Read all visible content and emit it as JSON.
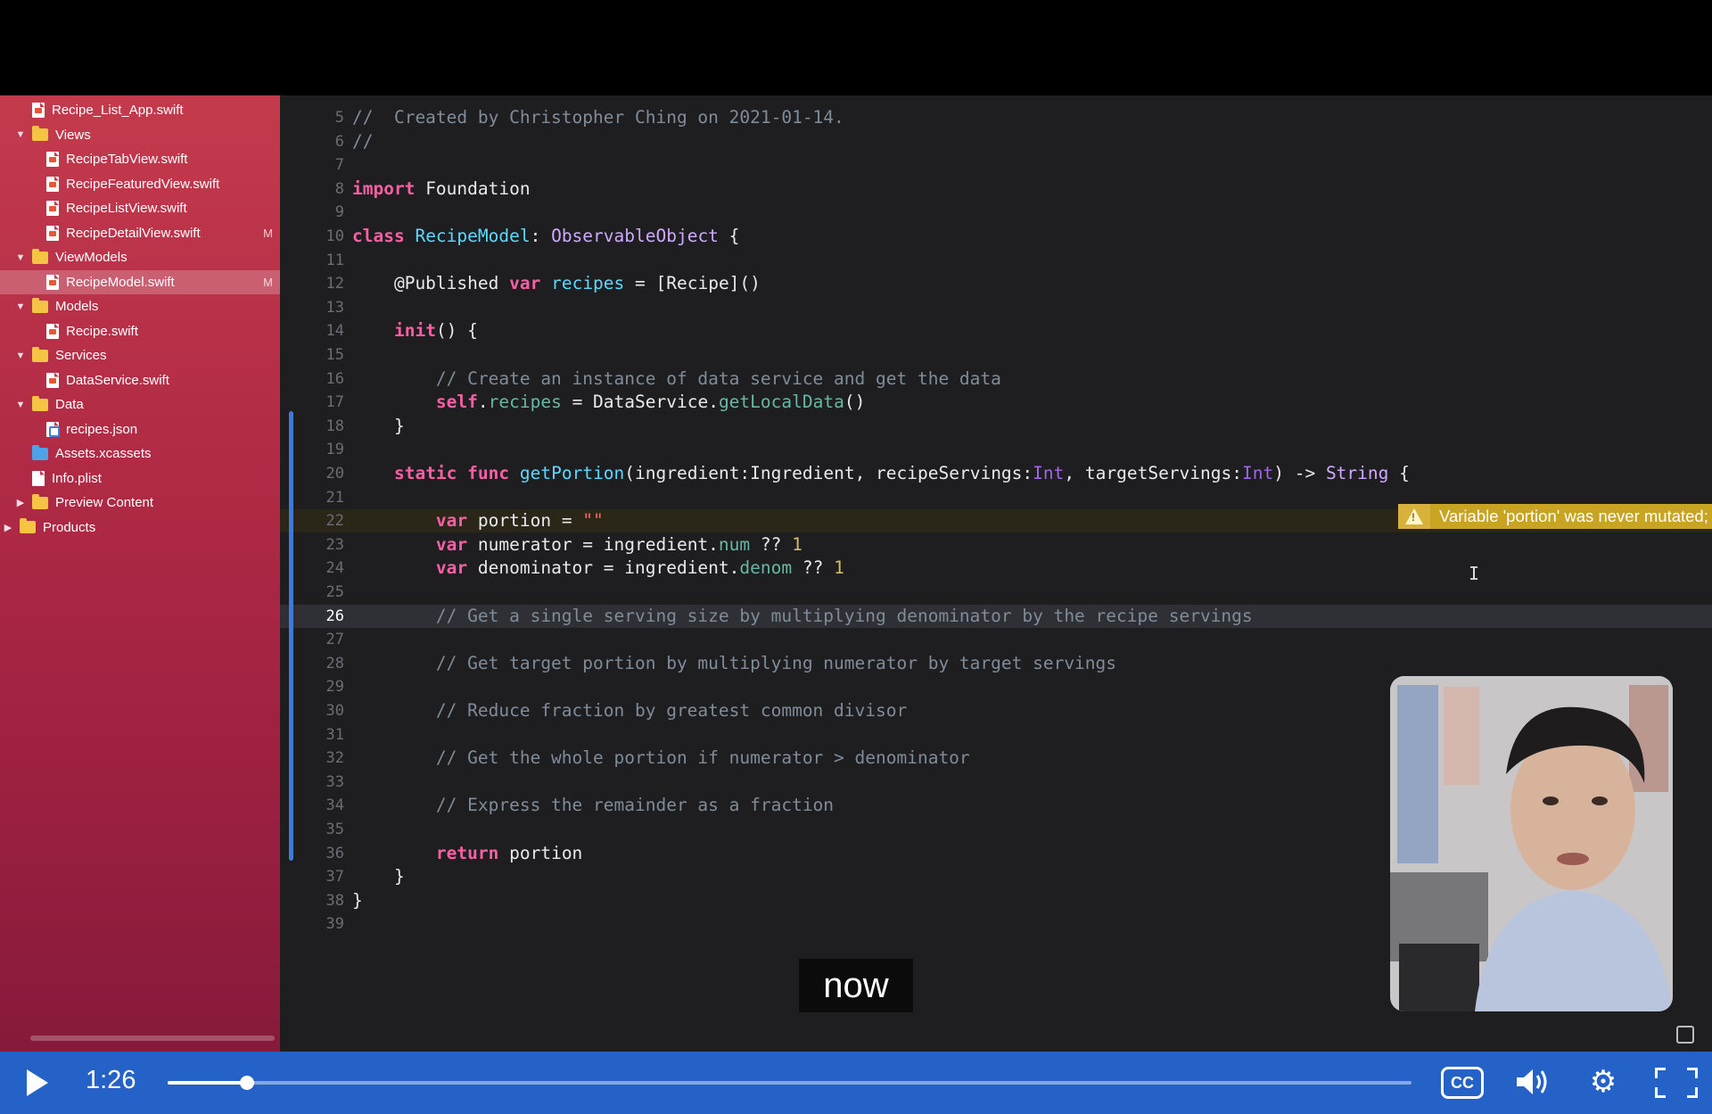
{
  "sidebar": {
    "items": [
      {
        "label": "Recipe_List_App.swift",
        "kind": "swift",
        "disclosure": "none",
        "badge": ""
      },
      {
        "label": "Views",
        "kind": "folder",
        "disclosure": "open",
        "badge": ""
      },
      {
        "label": "RecipeTabView.swift",
        "kind": "swift",
        "disclosure": "none",
        "badge": ""
      },
      {
        "label": "RecipeFeaturedView.swift",
        "kind": "swift",
        "disclosure": "none",
        "badge": ""
      },
      {
        "label": "RecipeListView.swift",
        "kind": "swift",
        "disclosure": "none",
        "badge": ""
      },
      {
        "label": "RecipeDetailView.swift",
        "kind": "swift",
        "disclosure": "none",
        "badge": "M"
      },
      {
        "label": "ViewModels",
        "kind": "folder",
        "disclosure": "open",
        "badge": ""
      },
      {
        "label": "RecipeModel.swift",
        "kind": "swift",
        "disclosure": "none",
        "badge": "M",
        "selected": true
      },
      {
        "label": "Models",
        "kind": "folder",
        "disclosure": "open",
        "badge": ""
      },
      {
        "label": "Recipe.swift",
        "kind": "swift",
        "disclosure": "none",
        "badge": ""
      },
      {
        "label": "Services",
        "kind": "folder",
        "disclosure": "open",
        "badge": ""
      },
      {
        "label": "DataService.swift",
        "kind": "swift",
        "disclosure": "none",
        "badge": ""
      },
      {
        "label": "Data",
        "kind": "folder",
        "disclosure": "open",
        "badge": ""
      },
      {
        "label": "recipes.json",
        "kind": "json",
        "disclosure": "none",
        "badge": ""
      },
      {
        "label": "Assets.xcassets",
        "kind": "asset",
        "disclosure": "none",
        "badge": ""
      },
      {
        "label": "Info.plist",
        "kind": "file",
        "disclosure": "none",
        "badge": ""
      },
      {
        "label": "Preview Content",
        "kind": "folder",
        "disclosure": "closed",
        "badge": ""
      },
      {
        "label": "Products",
        "kind": "folder",
        "disclosure": "closed",
        "badge": ""
      }
    ]
  },
  "editor": {
    "current_line": 26,
    "warning_line": 22,
    "lines": [
      {
        "n": 5,
        "code": [
          [
            "cm",
            "//  Created by Christopher Ching on 2021-01-14."
          ]
        ]
      },
      {
        "n": 6,
        "code": [
          [
            "cm",
            "//"
          ]
        ]
      },
      {
        "n": 7,
        "code": []
      },
      {
        "n": 8,
        "code": [
          [
            "kw",
            "import"
          ],
          [
            "",
            " Foundation"
          ]
        ]
      },
      {
        "n": 9,
        "code": []
      },
      {
        "n": 10,
        "code": [
          [
            "kw",
            "class"
          ],
          [
            "",
            " "
          ],
          [
            "prop",
            "RecipeModel"
          ],
          [
            "",
            ": "
          ],
          [
            "ty",
            "ObservableObject"
          ],
          [
            "",
            " {"
          ]
        ]
      },
      {
        "n": 11,
        "code": []
      },
      {
        "n": 12,
        "code": [
          [
            "",
            "    @Published "
          ],
          [
            "kw",
            "var"
          ],
          [
            "",
            " "
          ],
          [
            "prop",
            "recipes"
          ],
          [
            "",
            " = [Recipe]()"
          ]
        ]
      },
      {
        "n": 13,
        "code": []
      },
      {
        "n": 14,
        "code": [
          [
            "",
            "    "
          ],
          [
            "kw",
            "init"
          ],
          [
            "",
            "() {"
          ]
        ]
      },
      {
        "n": 15,
        "code": []
      },
      {
        "n": 16,
        "code": [
          [
            "cm",
            "        // Create an instance of data service and get the data"
          ]
        ]
      },
      {
        "n": 17,
        "code": [
          [
            "",
            "        "
          ],
          [
            "kw",
            "self"
          ],
          [
            "",
            "."
          ],
          [
            "fn",
            "recipes"
          ],
          [
            "",
            " = DataService."
          ],
          [
            "fn",
            "getLocalData"
          ],
          [
            "",
            "()"
          ]
        ]
      },
      {
        "n": 18,
        "code": [
          [
            "",
            "    }"
          ]
        ]
      },
      {
        "n": 19,
        "code": []
      },
      {
        "n": 20,
        "code": [
          [
            "",
            "    "
          ],
          [
            "kw",
            "static"
          ],
          [
            "",
            " "
          ],
          [
            "kw",
            "func"
          ],
          [
            "",
            " "
          ],
          [
            "prop",
            "getPortion"
          ],
          [
            "",
            "(ingredient:Ingredient, recipeServings:"
          ],
          [
            "ty2",
            "Int"
          ],
          [
            "",
            ", targetServings:"
          ],
          [
            "ty2",
            "Int"
          ],
          [
            "",
            ") -> "
          ],
          [
            "ty",
            "String"
          ],
          [
            "",
            " {"
          ]
        ]
      },
      {
        "n": 21,
        "code": []
      },
      {
        "n": 22,
        "code": [
          [
            "",
            "        "
          ],
          [
            "kw",
            "var"
          ],
          [
            "",
            " portion = "
          ],
          [
            "str",
            "\"\""
          ]
        ]
      },
      {
        "n": 23,
        "code": [
          [
            "",
            "        "
          ],
          [
            "kw",
            "var"
          ],
          [
            "",
            " numerator = ingredient."
          ],
          [
            "fn",
            "num"
          ],
          [
            "",
            " ?? "
          ],
          [
            "num",
            "1"
          ]
        ]
      },
      {
        "n": 24,
        "code": [
          [
            "",
            "        "
          ],
          [
            "kw",
            "var"
          ],
          [
            "",
            " denominator = ingredient."
          ],
          [
            "fn",
            "denom"
          ],
          [
            "",
            " ?? "
          ],
          [
            "num",
            "1"
          ]
        ]
      },
      {
        "n": 25,
        "code": []
      },
      {
        "n": 26,
        "code": [
          [
            "cm",
            "        // Get a single serving size by multiplying denominator by the recipe servings"
          ]
        ]
      },
      {
        "n": 27,
        "code": []
      },
      {
        "n": 28,
        "code": [
          [
            "cm",
            "        // Get target portion by multiplying numerator by target servings"
          ]
        ]
      },
      {
        "n": 29,
        "code": []
      },
      {
        "n": 30,
        "code": [
          [
            "cm",
            "        // Reduce fraction by greatest common divisor"
          ]
        ]
      },
      {
        "n": 31,
        "code": []
      },
      {
        "n": 32,
        "code": [
          [
            "cm",
            "        // Get the whole portion if numerator > denominator"
          ]
        ]
      },
      {
        "n": 33,
        "code": []
      },
      {
        "n": 34,
        "code": [
          [
            "cm",
            "        // Express the remainder as a fraction"
          ]
        ]
      },
      {
        "n": 35,
        "code": []
      },
      {
        "n": 36,
        "code": [
          [
            "",
            "        "
          ],
          [
            "kw",
            "return"
          ],
          [
            "",
            " portion"
          ]
        ]
      },
      {
        "n": 37,
        "code": [
          [
            "",
            "    }"
          ]
        ]
      },
      {
        "n": 38,
        "code": [
          [
            "",
            "}"
          ]
        ]
      },
      {
        "n": 39,
        "code": []
      }
    ],
    "warning_text": "Variable 'portion' was never mutated; consider changing to 'let' consta"
  },
  "caption": {
    "text": "now"
  },
  "player": {
    "time": "1:26",
    "progress": 0.064,
    "cc_label": "CC",
    "accent_color": "#2462c7"
  }
}
